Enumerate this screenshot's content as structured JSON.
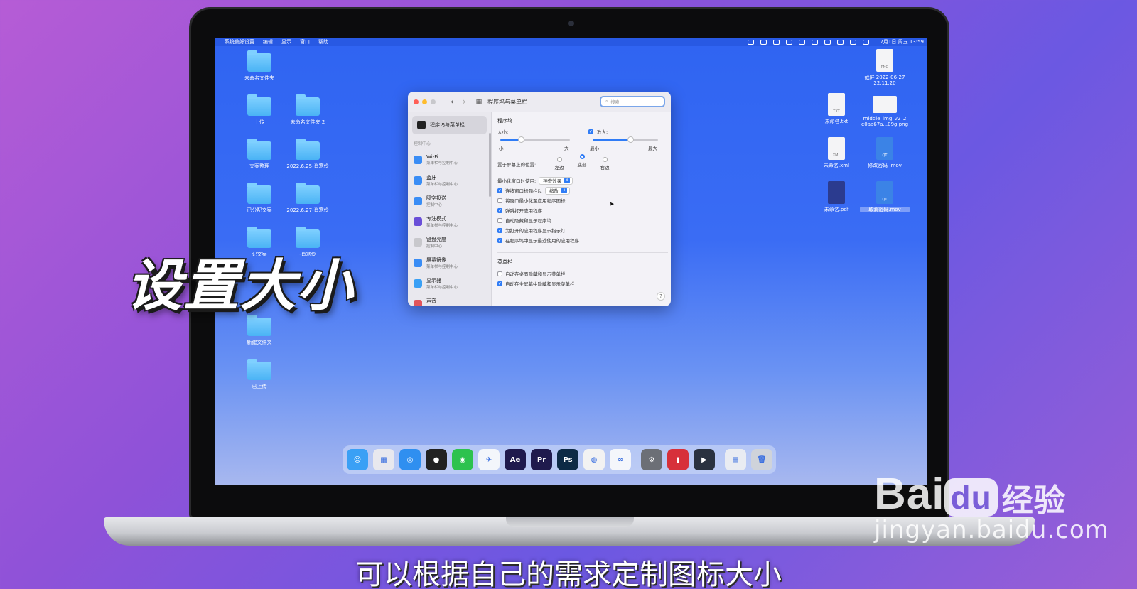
{
  "overlay": {
    "title": "设置大小",
    "subtitle": "可以根据自己的需求定制图标大小"
  },
  "watermark": {
    "brand_a": "Bai",
    "brand_b": "du",
    "brand_cn": "经验",
    "url": "jingyan.baidu.com"
  },
  "menubar": {
    "apple": "",
    "items": [
      "系统偏好设置",
      "编辑",
      "显示",
      "窗口",
      "帮助"
    ],
    "clock": "7月1日 周五 13:59"
  },
  "desktop": {
    "left_icons": [
      {
        "label": "未命名文件夹"
      },
      {
        "label": "上传"
      },
      {
        "label": "未命名文件夹 2"
      },
      {
        "label": "文案整理"
      },
      {
        "label": "2022.6.25-肖寒伶"
      },
      {
        "label": "已分配文案"
      },
      {
        "label": "2022.6.27-肖寒伶"
      },
      {
        "label": "记文案"
      },
      {
        "label": "-肖寒伶"
      },
      {
        "label": "新建文件夹"
      },
      {
        "label": "已上传"
      }
    ],
    "right_icons": [
      {
        "label": "截屏 2022-06-27 22.11.20",
        "badge": "PNG"
      },
      {
        "label": "未命名.txt",
        "badge": "TXT"
      },
      {
        "label": "middle_img_v2_2 e0aa67a...09g.png",
        "badge": ""
      },
      {
        "label": "未命名.xml",
        "badge": "XML"
      },
      {
        "label": "修改密码 .mov",
        "badge": "QT"
      },
      {
        "label": "未命名.pdf",
        "badge": ""
      },
      {
        "label": "取消密码.mov",
        "badge": "QT"
      }
    ]
  },
  "window": {
    "title": "程序坞与菜单栏",
    "nav_back": "‹",
    "nav_forward": "›",
    "grid_icon": "▦",
    "search_placeholder": "搜索",
    "sidebar": {
      "selected": "程序坞与菜单栏",
      "section": "控制中心",
      "items": [
        {
          "title": "Wi-Fi",
          "sub": "菜单栏与控制中心",
          "color": "#3a8df5"
        },
        {
          "title": "蓝牙",
          "sub": "菜单栏与控制中心",
          "color": "#3a8df5"
        },
        {
          "title": "隔空投送",
          "sub": "控制中心",
          "color": "#3a8df5"
        },
        {
          "title": "专注模式",
          "sub": "菜单栏与控制中心",
          "color": "#6a4fd8"
        },
        {
          "title": "键盘亮度",
          "sub": "控制中心",
          "color": "#c8c8cc"
        },
        {
          "title": "屏幕镜像",
          "sub": "菜单栏与控制中心",
          "color": "#3a8df5"
        },
        {
          "title": "显示器",
          "sub": "菜单栏与控制中心",
          "color": "#3aa0f5"
        },
        {
          "title": "声音",
          "sub": "菜单栏与控制中心",
          "color": "#e2555c"
        }
      ]
    },
    "dock_section": "程序坞",
    "size_label": "大小:",
    "size_min": "小",
    "size_max": "大",
    "size_value": 0.3,
    "magnify_label": "放大:",
    "magnify_checked": true,
    "magnify_min": "最小",
    "magnify_max": "最大",
    "magnify_value": 0.58,
    "position_label": "置于屏幕上的位置:",
    "position_options": [
      "左边",
      "底部",
      "右边"
    ],
    "position_selected": 1,
    "minimize_label": "最小化窗口时使用:",
    "minimize_value": "神奇效果",
    "doubleclick_label": "连按窗口标题栏以",
    "doubleclick_value": "缩放",
    "checkboxes": [
      {
        "label": "将窗口最小化至应用程序图标",
        "checked": false
      },
      {
        "label": "弹跳打开应用程序",
        "checked": true
      },
      {
        "label": "自动隐藏和显示程序坞",
        "checked": false
      },
      {
        "label": "为打开的应用程序显示指示灯",
        "checked": true
      },
      {
        "label": "在程序坞中显示最近使用的应用程序",
        "checked": true
      }
    ],
    "menubar_section": "菜单栏",
    "menubar_checks": [
      {
        "label": "自动在桌面隐藏和显示菜单栏",
        "checked": false
      },
      {
        "label": "自动在全屏幕中隐藏和显示菜单栏",
        "checked": true
      }
    ],
    "help": "?"
  },
  "dock": {
    "apps": [
      {
        "name": "finder",
        "glyph": "☺",
        "color": "#3aa0f5"
      },
      {
        "name": "launchpad",
        "glyph": "▦",
        "color": "#e8e8ee"
      },
      {
        "name": "safari",
        "glyph": "◎",
        "color": "#2f8ff0"
      },
      {
        "name": "qq",
        "glyph": "●",
        "color": "#222222"
      },
      {
        "name": "wechat",
        "glyph": "◉",
        "color": "#2dc24e"
      },
      {
        "name": "feishu",
        "glyph": "✈",
        "color": "#f3f6fb"
      },
      {
        "name": "aftereffects",
        "glyph": "Ae",
        "color": "#1f1a4d"
      },
      {
        "name": "premiere",
        "glyph": "Pr",
        "color": "#1f1a4d"
      },
      {
        "name": "photoshop",
        "glyph": "Ps",
        "color": "#0d2a45"
      },
      {
        "name": "chrome",
        "glyph": "◍",
        "color": "#f2f2f2"
      },
      {
        "name": "baidunetdisk",
        "glyph": "∞",
        "color": "#f4f6fb"
      },
      {
        "name": "systempreferences",
        "glyph": "⚙",
        "color": "#6c6f76"
      },
      {
        "name": "parallels",
        "glyph": "▮",
        "color": "#d7303a"
      },
      {
        "name": "quicktime",
        "glyph": "▶",
        "color": "#2a3240"
      },
      {
        "name": "preview",
        "glyph": "▤",
        "color": "#e9ecf2"
      },
      {
        "name": "trash",
        "glyph": "🗑",
        "color": "#cfd3da"
      }
    ]
  }
}
